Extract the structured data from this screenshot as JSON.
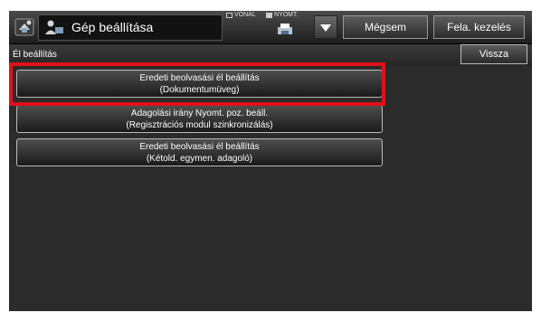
{
  "header": {
    "title": "Gép beállítása",
    "mode_line": "VONAL",
    "mode_print": "NYOMT.",
    "cancel_label": "Mégsem",
    "job_status_label": "Fela. kezelés"
  },
  "subheader": {
    "title": "Él beállítás",
    "back_label": "Vissza"
  },
  "options": [
    {
      "line1": "Eredeti beolvasási él beállítás",
      "line2": "(Dokumentumüveg)"
    },
    {
      "line1": "Adagolási irány Nyomt. poz. beáll.",
      "line2": "(Regisztrációs modul szinkronizálás)"
    },
    {
      "line1": "Eredeti beolvasási él beállítás",
      "line2": "(Kétold. egymen. adagoló)"
    }
  ],
  "colors": {
    "highlight": "#e0101a",
    "background": "#2b2b2b"
  }
}
